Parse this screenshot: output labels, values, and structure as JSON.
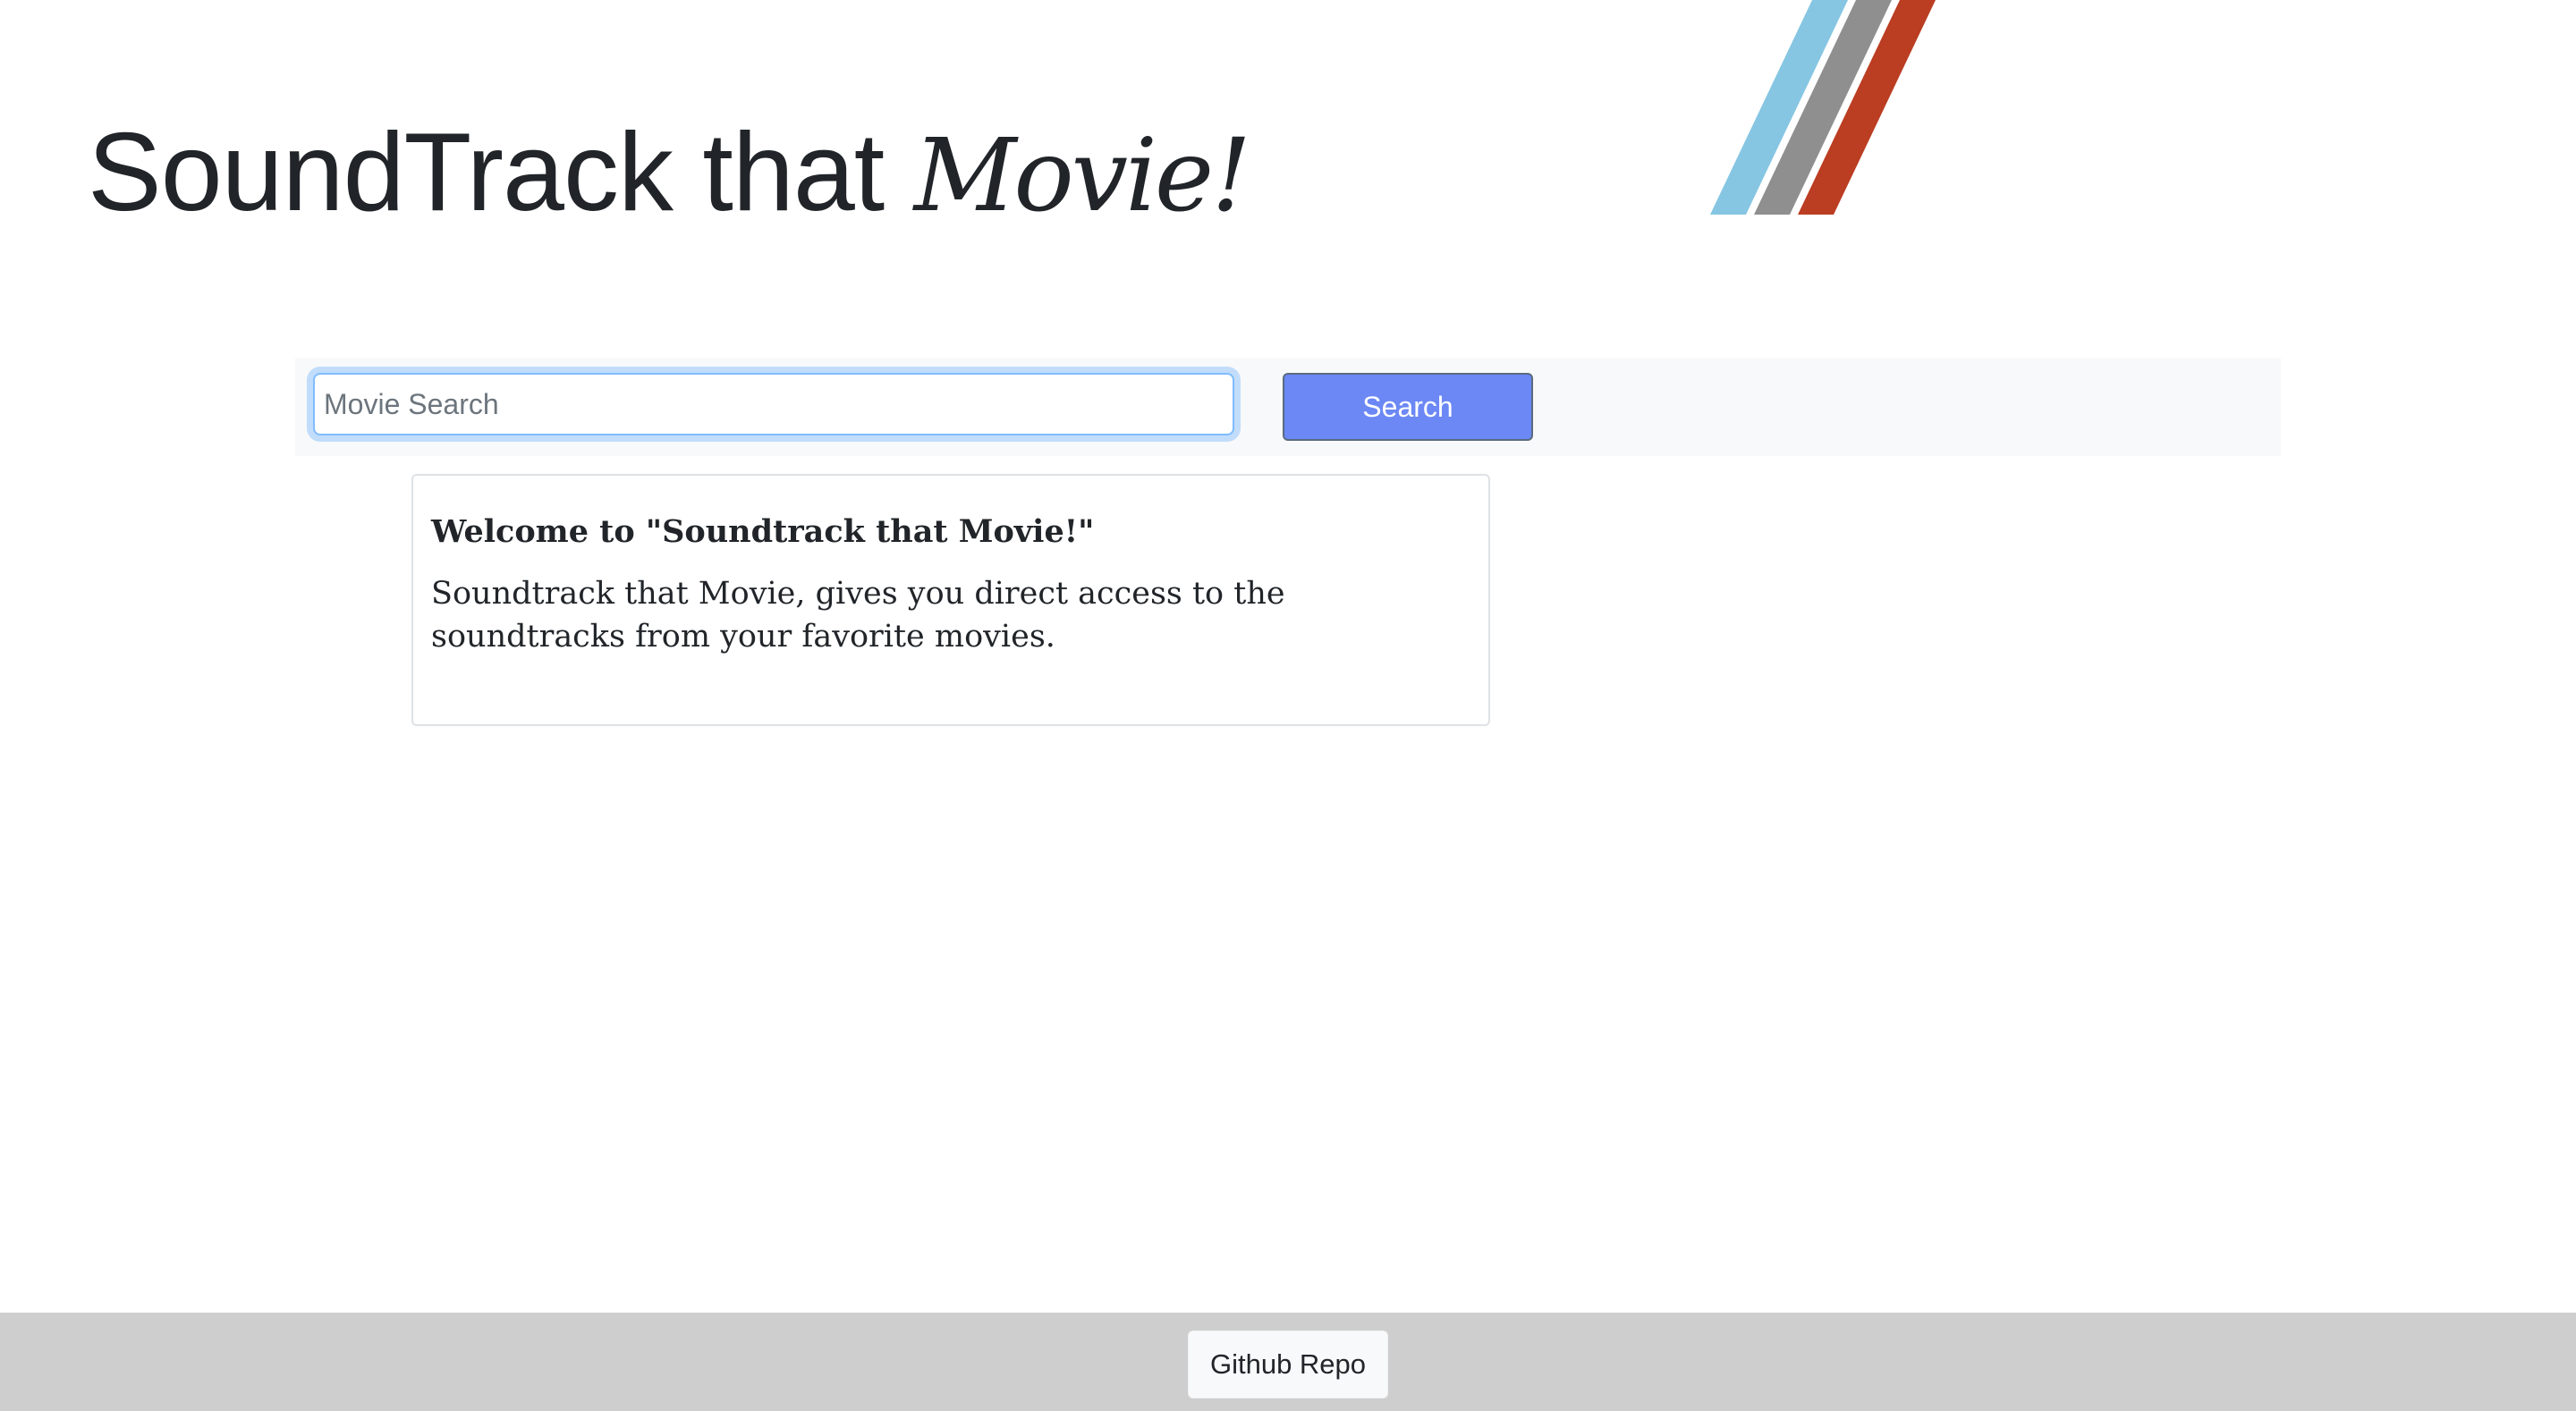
{
  "header": {
    "title_main": "SoundTrack that ",
    "title_accent": "Movie!"
  },
  "search": {
    "placeholder": "Movie Search",
    "value": "",
    "button_label": "Search"
  },
  "welcome_card": {
    "title": "Welcome to \"Soundtrack that Movie!\"",
    "text": "Soundtrack that Movie, gives you direct access to the soundtracks from your favorite movies."
  },
  "footer": {
    "repo_button_label": "Github Repo"
  },
  "colors": {
    "stripe_blue": "#86c6e2",
    "stripe_gray": "#8f8f8f",
    "stripe_red": "#bb3d22",
    "search_button": "#6b88f5",
    "footer_bg": "#cecece"
  }
}
